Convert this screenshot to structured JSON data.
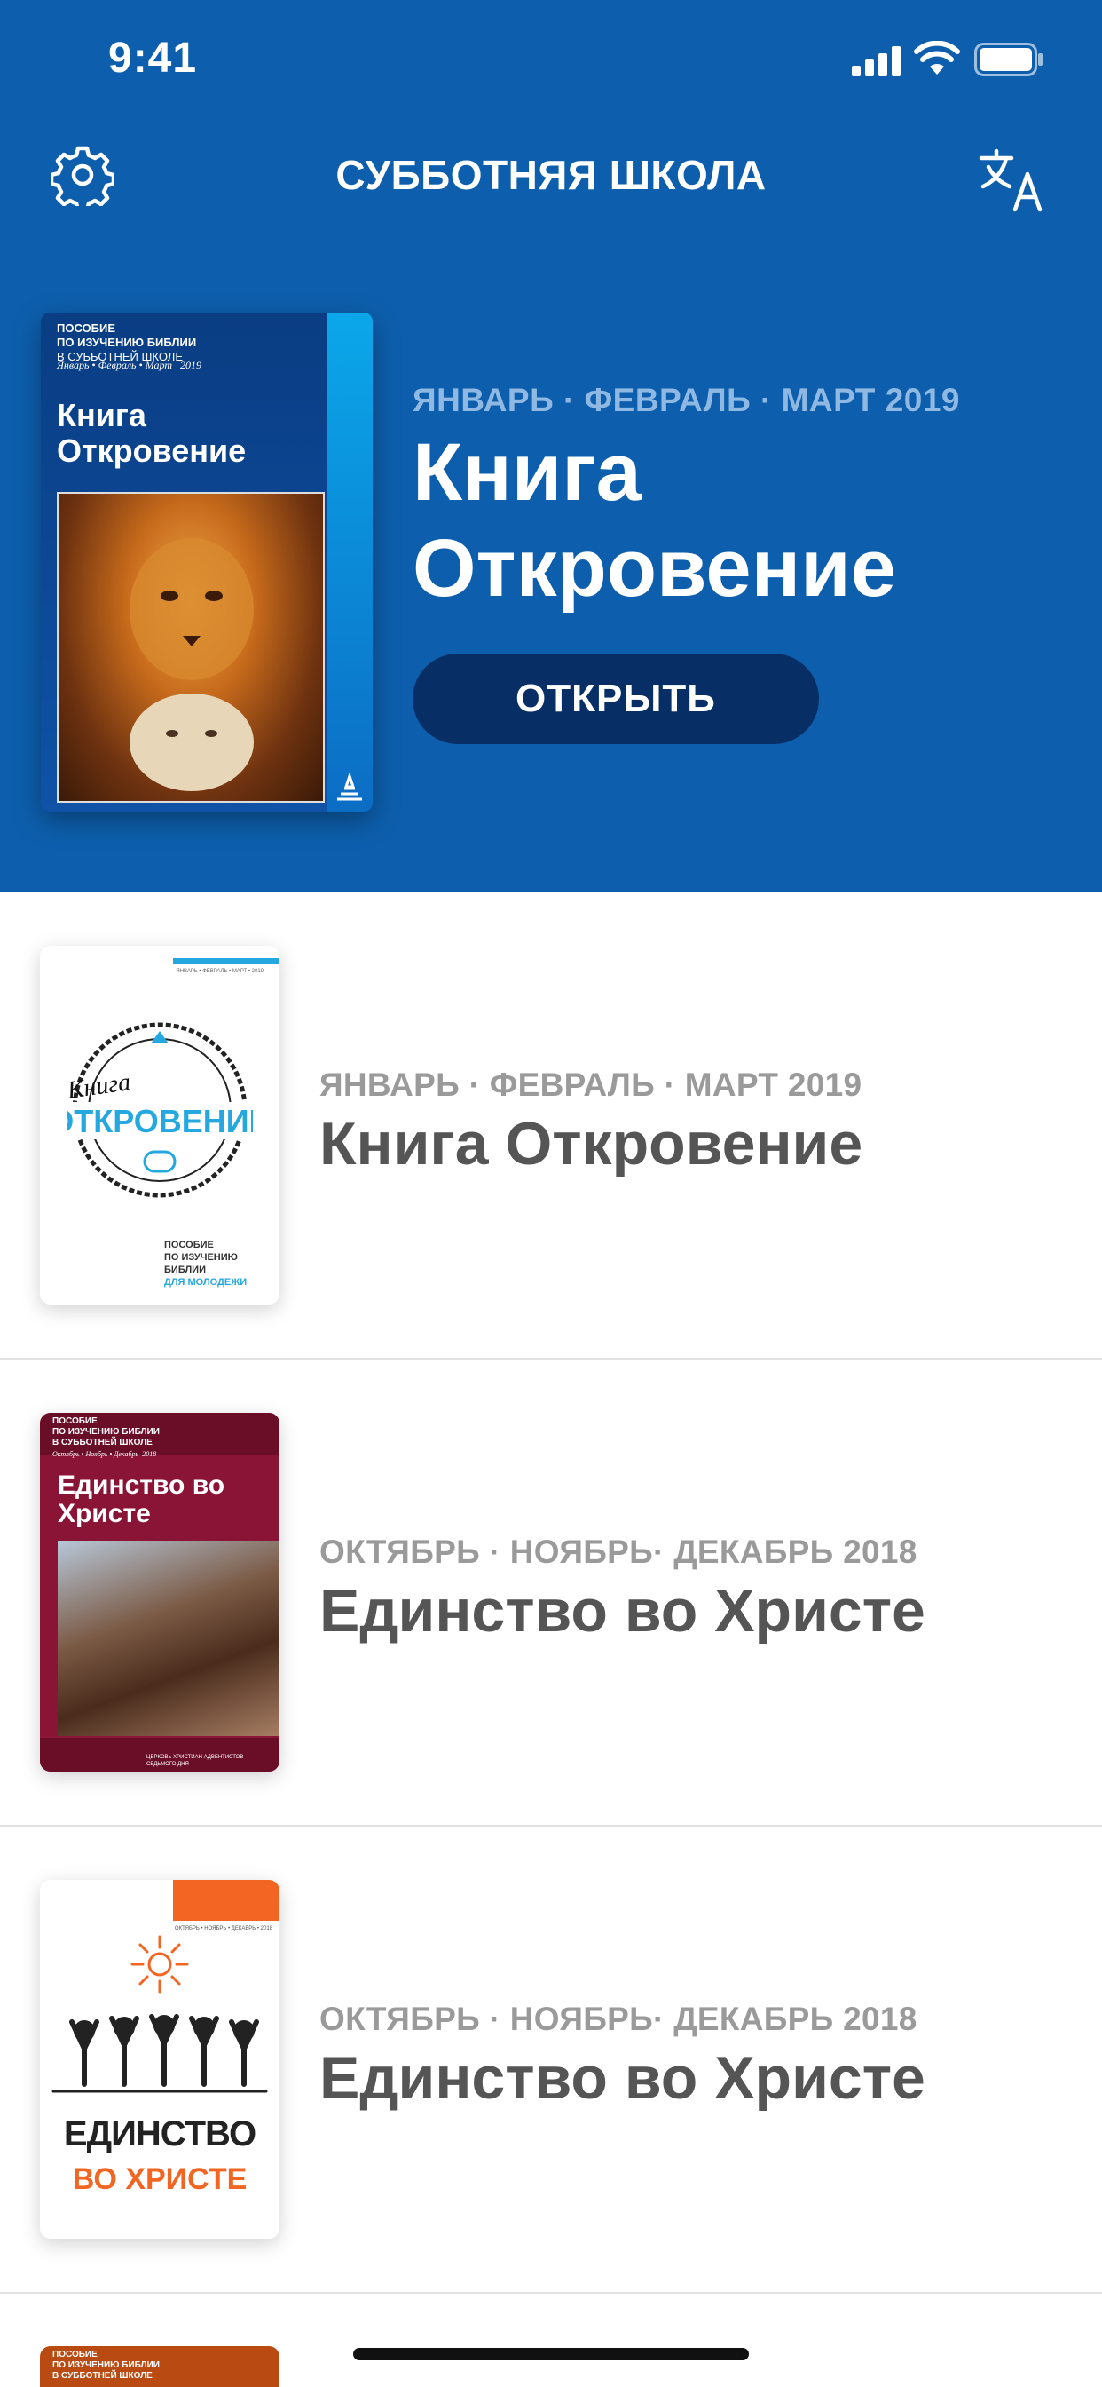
{
  "status_bar": {
    "time": "9:41"
  },
  "nav": {
    "title": "СУББОТНЯЯ ШКОЛА",
    "settings_icon": "gear-icon",
    "translate_icon": "translate-icon"
  },
  "featured": {
    "date": "ЯНВАРЬ · ФЕВРАЛЬ · МАРТ 2019",
    "title": "Книга Откровение",
    "open_label": "ОТКРЫТЬ",
    "cover": {
      "top_line1": "ПОСОБИЕ",
      "top_line2": "ПО ИЗУЧЕНИЮ БИБЛИИ",
      "top_line3": "В СУББОТНЕЙ ШКОЛЕ",
      "months": "Январь • Февраль • Март",
      "year": "2019",
      "title": "Книга Откровение"
    }
  },
  "items": [
    {
      "date": "ЯНВАРЬ · ФЕВРАЛЬ · МАРТ 2019",
      "title": "Книга Откровение",
      "cover": {
        "top": "ЯНВАРЬ • ФЕВРАЛЬ • МАРТ • 2019",
        "stamp_top": "Книга",
        "stamp_main": "ОТКРОВЕНИЕ",
        "bottom1": "ПОСОБИЕ",
        "bottom2": "ПО ИЗУЧЕНИЮ БИБЛИИ",
        "bottom3": "ДЛЯ МОЛОДЕЖИ"
      }
    },
    {
      "date": "ОКТЯБРЬ · НОЯБРЬ· ДЕКАБРЬ 2018",
      "title": "Единство во Христе",
      "cover": {
        "top1": "ПОСОБИЕ",
        "top2": "ПО ИЗУЧЕНИЮ БИБЛИИ",
        "top3": "В СУББОТНЕЙ ШКОЛЕ",
        "months": "Октябрь • Ноябрь • Декабрь",
        "year": "2018",
        "title": "Единство во Христе",
        "footer": "ЦЕРКОВЬ ХРИСТИАН АДВЕНТИСТОВ СЕДЬМОГО ДНЯ"
      }
    },
    {
      "date": "ОКТЯБРЬ · НОЯБРЬ· ДЕКАБРЬ 2018",
      "title": "Единство во Христе",
      "cover": {
        "months": "ОКТЯБРЬ • НОЯБРЬ • ДЕКАБРЬ • 2018",
        "word1": "ЕДИНСТВО",
        "word2": "ВО ХРИСТЕ"
      }
    }
  ],
  "partial_item": {
    "cover": {
      "top1": "ПОСОБИЕ",
      "top2": "ПО ИЗУЧЕНИЮ БИБЛИИ",
      "top3": "В СУББОТНЕЙ ШКОЛЕ"
    }
  },
  "colors": {
    "header_blue": "#0d5fad",
    "button_navy": "#072f66",
    "date_light_blue": "#8fb8e3",
    "list_title": "#555555",
    "list_date": "#9a9a9a"
  }
}
